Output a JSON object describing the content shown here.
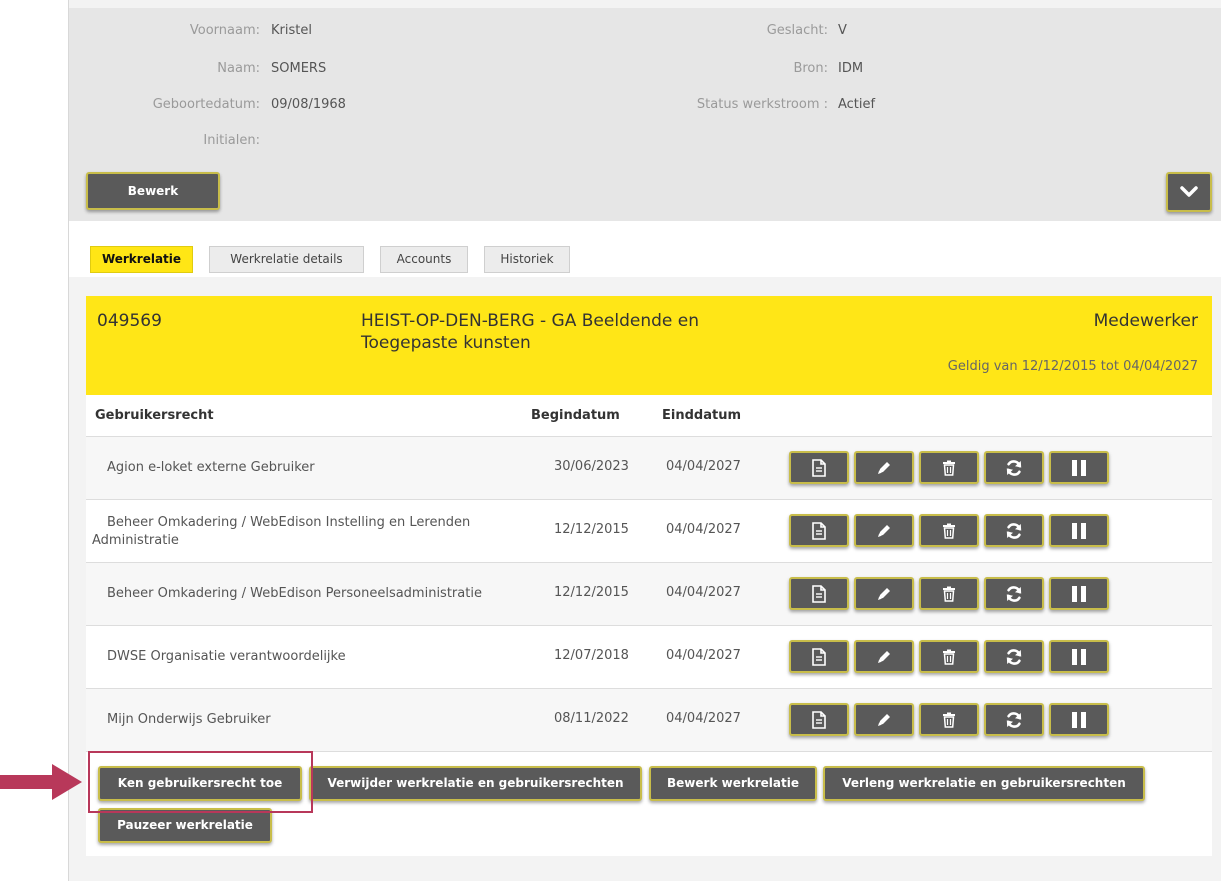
{
  "profile": {
    "voornaam_label": "Voornaam:",
    "voornaam_value": "Kristel",
    "naam_label": "Naam:",
    "naam_value": "SOMERS",
    "geboortedatum_label": "Geboortedatum:",
    "geboortedatum_value": "09/08/1968",
    "initialen_label": "Initialen:",
    "initialen_value": "",
    "geslacht_label": "Geslacht:",
    "geslacht_value": "V",
    "bron_label": "Bron:",
    "bron_value": "IDM",
    "status_label": "Status werkstroom :",
    "status_value": "Actief",
    "edit_label": "Bewerk",
    "collapse_icon": "chevron-down-icon"
  },
  "tabs": [
    {
      "label": "Werkrelatie",
      "active": true
    },
    {
      "label": "Werkrelatie details",
      "active": false
    },
    {
      "label": "Accounts",
      "active": false
    },
    {
      "label": "Historiek",
      "active": false
    }
  ],
  "relation": {
    "number": "049569",
    "institution_line1": "HEIST-OP-DEN-BERG - GA Beeldende en",
    "institution_line2": "Toegepaste kunsten",
    "role": "Medewerker",
    "validity": "Geldig van 12/12/2015 tot 04/04/2027"
  },
  "table": {
    "headers": {
      "right": "Gebruikersrecht",
      "start": "Begindatum",
      "end": "Einddatum"
    },
    "rows": [
      {
        "name": "Agion e-loket externe Gebruiker",
        "name_line2": "",
        "start": "30/06/2023",
        "end": "04/04/2027"
      },
      {
        "name": "Beheer Omkadering / WebEdison Instelling en Lerenden",
        "name_line2": "Administratie",
        "start": "12/12/2015",
        "end": "04/04/2027"
      },
      {
        "name": "Beheer Omkadering / WebEdison Personeelsadministratie",
        "name_line2": "",
        "start": "12/12/2015",
        "end": "04/04/2027"
      },
      {
        "name": "DWSE Organisatie verantwoordelijke",
        "name_line2": "",
        "start": "12/07/2018",
        "end": "04/04/2027"
      },
      {
        "name": "Mijn Onderwijs Gebruiker",
        "name_line2": "",
        "start": "08/11/2022",
        "end": "04/04/2027"
      }
    ],
    "action_icons": [
      "document-icon",
      "pencil-icon",
      "trash-icon",
      "refresh-icon",
      "pause-icon"
    ]
  },
  "actions": {
    "grant": "Ken gebruikersrecht toe",
    "remove": "Verwijder werkrelatie en gebruikersrechten",
    "edit": "Bewerk werkrelatie",
    "extend": "Verleng werkrelatie en gebruikersrechten",
    "pause": "Pauzeer werkrelatie"
  },
  "colors": {
    "accent_yellow": "#ffe617",
    "button_gray": "#5a5a5a",
    "button_border": "#c8bd4a",
    "annotation_red": "#b8385a"
  }
}
